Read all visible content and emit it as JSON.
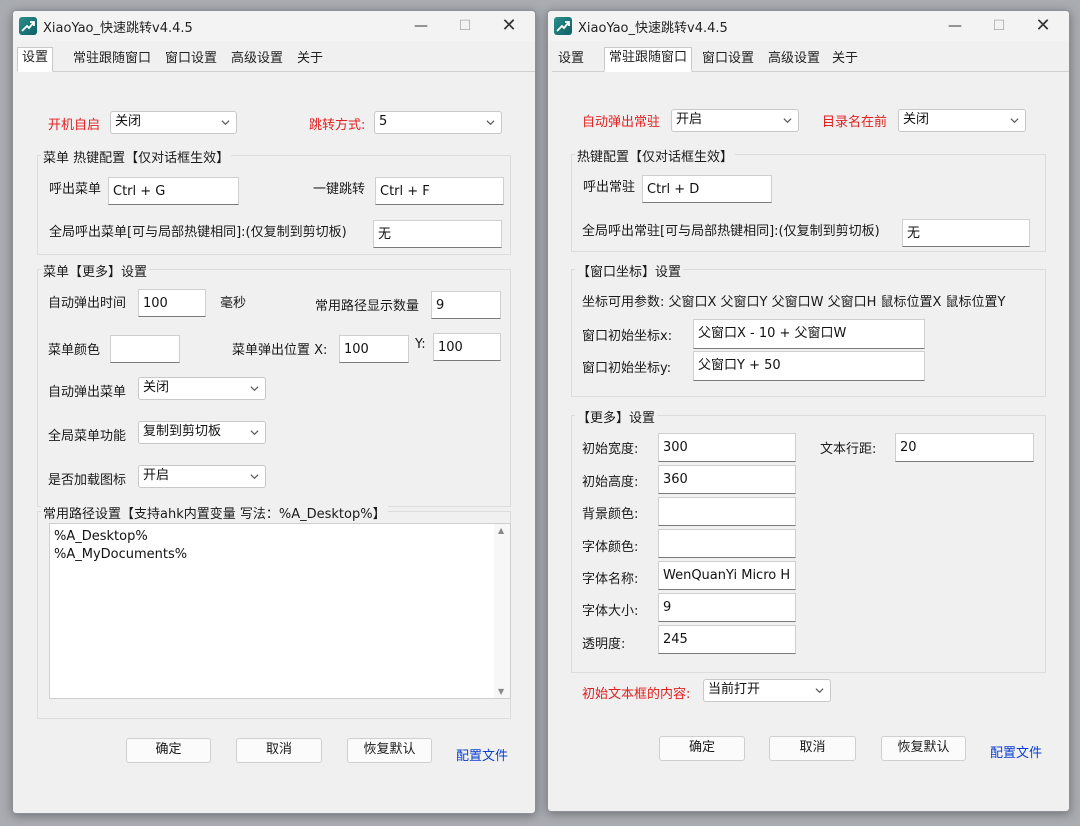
{
  "title": "XiaoYao_快速跳转v4.4.5",
  "window_controls": {
    "min": "—",
    "max": "☐",
    "close": "✕"
  },
  "tabs": [
    "设置",
    "常驻跟随窗口",
    "窗口设置",
    "高级设置",
    "关于"
  ],
  "left": {
    "autostart_label": "开机自启",
    "autostart_value": "关闭",
    "jump_label": "跳转方式:",
    "jump_value": "5",
    "hotkey_group": "菜单 热键配置【仅对话框生效】",
    "call_menu_label": "呼出菜单",
    "call_menu_value": "Ctrl + G",
    "one_key_label": "一键跳转",
    "one_key_value": "Ctrl + F",
    "global_menu_label": "全局呼出菜单[可与局部热键相同]:(仅复制到剪切板)",
    "global_menu_value": "无",
    "more_group": "菜单【更多】设置",
    "auto_time_label": "自动弹出时间",
    "auto_time_value": "100",
    "ms_label": "毫秒",
    "path_count_label": "常用路径显示数量",
    "path_count_value": "9",
    "menu_color_label": "菜单颜色",
    "menu_color_value": "",
    "popup_x_label": "菜单弹出位置 X:",
    "popup_x_value": "100",
    "popup_y_label": "Y:",
    "popup_y_value": "100",
    "auto_popup_label": "自动弹出菜单",
    "auto_popup_value": "关闭",
    "global_func_label": "全局菜单功能",
    "global_func_value": "复制到剪切板",
    "load_icon_label": "是否加载图标",
    "load_icon_value": "开启",
    "paths_group": "常用路径设置【支持ahk内置变量 写法：%A_Desktop%】",
    "paths": [
      "%A_Desktop%",
      "%A_MyDocuments%"
    ],
    "ok": "确定",
    "cancel": "取消",
    "reset": "恢复默认",
    "config_file": "配置文件"
  },
  "right": {
    "auto_resident_label": "自动弹出常驻",
    "auto_resident_value": "开启",
    "dir_first_label": "目录名在前",
    "dir_first_value": "关闭",
    "hotkey_group": "热键配置【仅对话框生效】",
    "call_resident_label": "呼出常驻",
    "call_resident_value": "Ctrl + D",
    "global_resident_label": "全局呼出常驻[可与局部热键相同]:(仅复制到剪切板)",
    "global_resident_value": "无",
    "coord_group": "【窗口坐标】设置",
    "coord_params": "坐标可用参数: 父窗口X 父窗口Y 父窗口W 父窗口H 鼠标位置X 鼠标位置Y",
    "init_x_label": "窗口初始坐标x:",
    "init_x_value": "父窗口X - 10 + 父窗口W",
    "init_y_label": "窗口初始坐标y:",
    "init_y_value": "父窗口Y + 50",
    "more_group": "【更多】设置",
    "init_width_label": "初始宽度:",
    "init_width_value": "300",
    "line_spacing_label": "文本行距:",
    "line_spacing_value": "20",
    "init_height_label": "初始高度:",
    "init_height_value": "360",
    "bg_color_label": "背景颜色:",
    "bg_color_value": "",
    "font_color_label": "字体颜色:",
    "font_color_value": "",
    "font_name_label": "字体名称:",
    "font_name_value": "WenQuanYi Micro H",
    "font_size_label": "字体大小:",
    "font_size_value": "9",
    "opacity_label": "透明度:",
    "opacity_value": "245",
    "init_text_label": "初始文本框的内容:",
    "init_text_value": "当前打开",
    "ok": "确定",
    "cancel": "取消",
    "reset": "恢复默认",
    "config_file": "配置文件"
  }
}
